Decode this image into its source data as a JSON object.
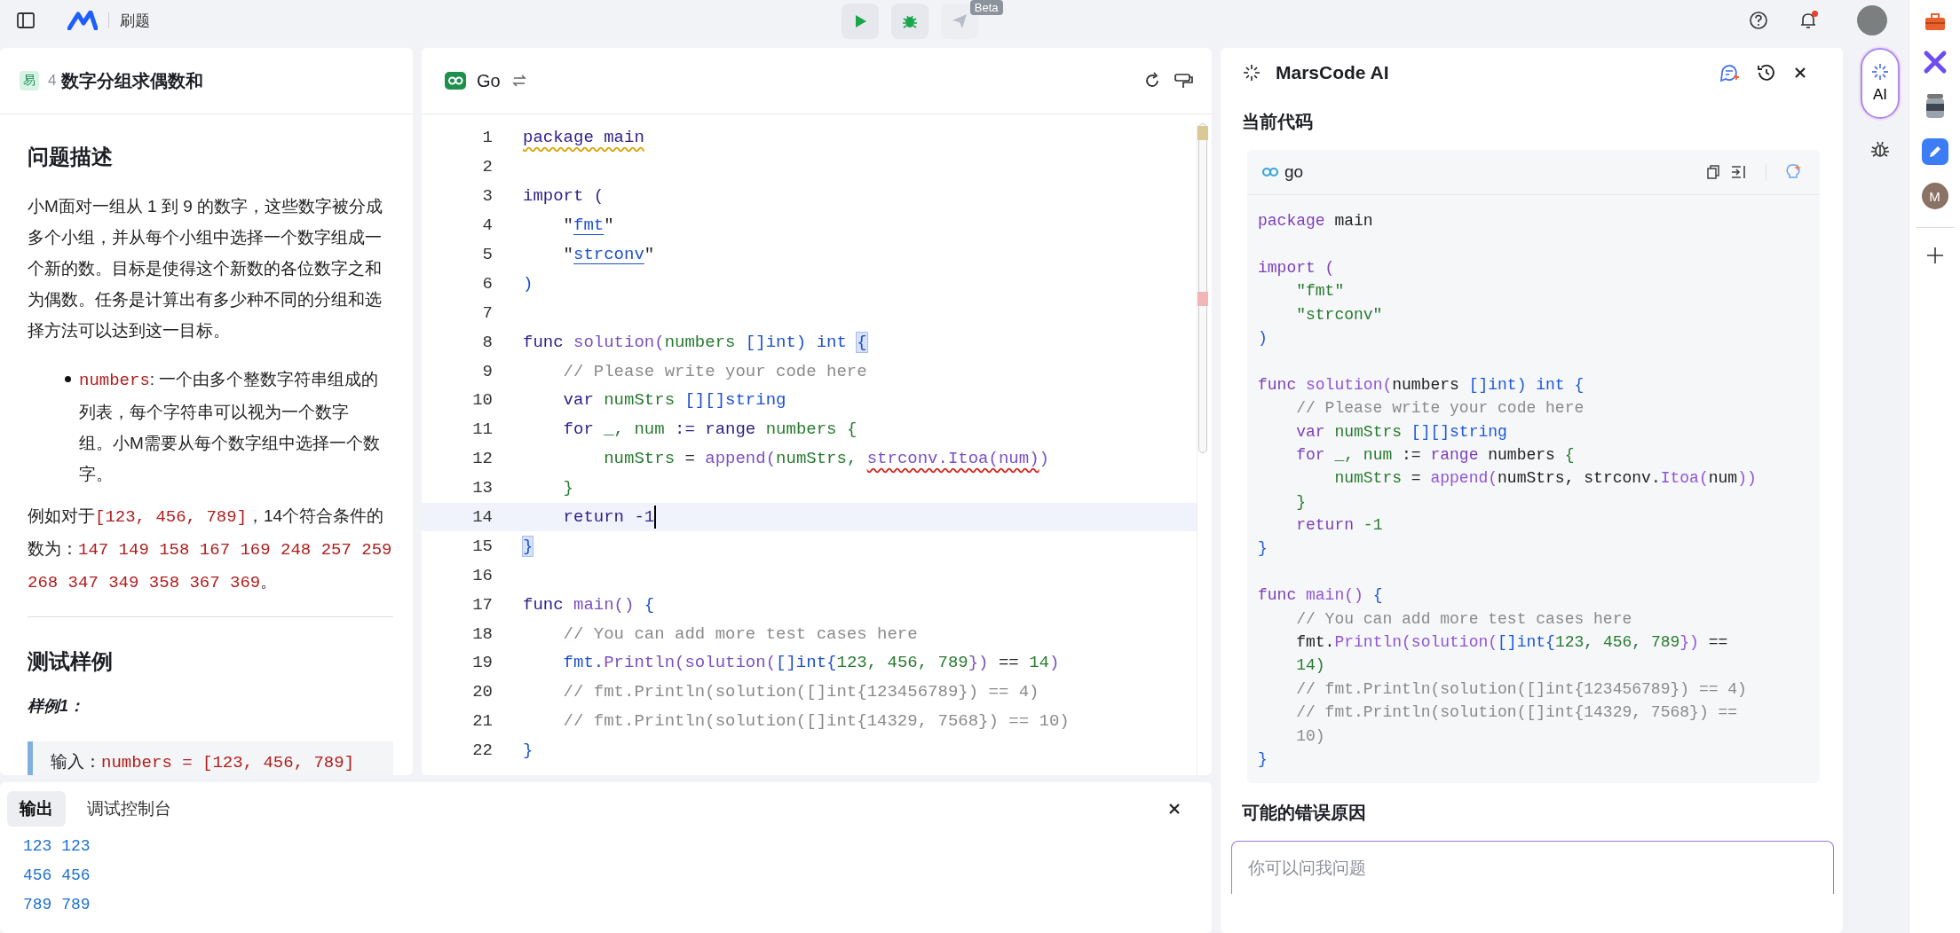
{
  "topbar": {
    "section": "刷题",
    "actions": [
      {
        "kind": "run",
        "disabled": false
      },
      {
        "kind": "debug",
        "disabled": false
      },
      {
        "kind": "submit",
        "disabled": true,
        "badge": "Beta"
      }
    ],
    "bell_unread": true
  },
  "problem": {
    "difficulty": "易",
    "number": "4",
    "title": "数字分组求偶数和",
    "description_heading": "问题描述",
    "description": "小M面对一组从 1 到 9 的数字，这些数字被分成多个小组，并从每个小组中选择一个数字组成一个新的数。目标是使得这个新数的各位数字之和为偶数。任务是计算出有多少种不同的分组和选择方法可以达到这一目标。",
    "params": [
      {
        "name": "numbers",
        "text": ": 一个由多个整数字符串组成的列表，每个字符串可以视为一个数字组。小M需要从每个数字组中选择一个数字。"
      }
    ],
    "example": [
      {
        "text": "例如对于",
        "kind": "text"
      },
      {
        "text": "[123, 456, 789]",
        "kind": "code"
      },
      {
        "text": "，14个符合条件的数为：",
        "kind": "text"
      },
      {
        "text": "147 149 158 167 169 248 257 259 268 347 349 358 367 369",
        "kind": "code"
      },
      {
        "text": "。",
        "kind": "text"
      }
    ],
    "tests_heading": "测试样例",
    "sample_label": "样例1：",
    "sample_input": [
      {
        "text": "输入：",
        "kind": "text"
      },
      {
        "text": "numbers = [123, 456, 789]",
        "kind": "code"
      }
    ]
  },
  "editor": {
    "language": "Go",
    "lines": [
      {
        "number": "1",
        "current": false,
        "kind": "code",
        "tokens": [
          {
            "text": "package main",
            "kind": "warn"
          }
        ]
      },
      {
        "number": "2",
        "current": false,
        "kind": "blank"
      },
      {
        "number": "3",
        "current": false,
        "kind": "code",
        "tokens": [
          {
            "text": "import (",
            "kind": "kw"
          }
        ]
      },
      {
        "number": "4",
        "current": false,
        "kind": "code",
        "tokens": [
          {
            "text": "    \"",
            "kind": "pl"
          },
          {
            "text": "fmt",
            "kind": "link"
          },
          {
            "text": "\"",
            "kind": "pl"
          }
        ]
      },
      {
        "number": "5",
        "current": false,
        "kind": "code",
        "tokens": [
          {
            "text": "    \"",
            "kind": "pl"
          },
          {
            "text": "strconv",
            "kind": "link"
          },
          {
            "text": "\"",
            "kind": "pl"
          }
        ]
      },
      {
        "number": "6",
        "current": false,
        "kind": "code",
        "tokens": [
          {
            "text": ")",
            "kind": "type"
          }
        ]
      },
      {
        "number": "7",
        "current": false,
        "kind": "blank"
      },
      {
        "number": "8",
        "current": false,
        "kind": "code",
        "tokens": [
          {
            "text": "func ",
            "kind": "kw"
          },
          {
            "text": "solution(",
            "kind": "fn"
          },
          {
            "text": "numbers ",
            "kind": "var"
          },
          {
            "text": "[]int) int ",
            "kind": "type"
          },
          {
            "text": "{",
            "kind": "match"
          }
        ]
      },
      {
        "number": "9",
        "current": false,
        "kind": "code",
        "tokens": [
          {
            "text": "    // Please write your code here",
            "kind": "cm"
          }
        ]
      },
      {
        "number": "10",
        "current": false,
        "kind": "code",
        "tokens": [
          {
            "text": "    var ",
            "kind": "kw"
          },
          {
            "text": "numStrs ",
            "kind": "var"
          },
          {
            "text": "[][]string",
            "kind": "type"
          }
        ]
      },
      {
        "number": "11",
        "current": false,
        "kind": "code",
        "tokens": [
          {
            "text": "    for ",
            "kind": "kw"
          },
          {
            "text": "_, num ",
            "kind": "var"
          },
          {
            "text": ":= range ",
            "kind": "kw"
          },
          {
            "text": "numbers {",
            "kind": "var"
          }
        ]
      },
      {
        "number": "12",
        "current": false,
        "kind": "code",
        "tokens": [
          {
            "text": "        numStrs ",
            "kind": "var"
          },
          {
            "text": "= ",
            "kind": "pl"
          },
          {
            "text": "append(",
            "kind": "fn"
          },
          {
            "text": "numStrs, ",
            "kind": "var"
          },
          {
            "text": "strconv.Itoa(num)",
            "kind": "err"
          },
          {
            "text": ")",
            "kind": "fn"
          }
        ]
      },
      {
        "number": "13",
        "current": false,
        "kind": "code",
        "tokens": [
          {
            "text": "    }",
            "kind": "var"
          }
        ]
      },
      {
        "number": "14",
        "current": true,
        "kind": "code",
        "tokens": [
          {
            "text": "    return -1",
            "kind": "kw"
          }
        ]
      },
      {
        "number": "15",
        "current": false,
        "kind": "code",
        "tokens": [
          {
            "text": "}",
            "kind": "match"
          }
        ]
      },
      {
        "number": "16",
        "current": false,
        "kind": "blank"
      },
      {
        "number": "17",
        "current": false,
        "kind": "code",
        "tokens": [
          {
            "text": "func ",
            "kind": "kw"
          },
          {
            "text": "main() ",
            "kind": "fn"
          },
          {
            "text": "{",
            "kind": "type"
          }
        ]
      },
      {
        "number": "18",
        "current": false,
        "kind": "code",
        "tokens": [
          {
            "text": "    // You can add more test cases here",
            "kind": "cm"
          }
        ]
      },
      {
        "number": "19",
        "current": false,
        "kind": "code",
        "tokens": [
          {
            "text": "    fmt.",
            "kind": "type"
          },
          {
            "text": "Println(solution(",
            "kind": "fn"
          },
          {
            "text": "[]int{",
            "kind": "type"
          },
          {
            "text": "123, 456, 789",
            "kind": "num"
          },
          {
            "text": "}) ",
            "kind": "fn"
          },
          {
            "text": "== ",
            "kind": "pl"
          },
          {
            "text": "14",
            "kind": "num"
          },
          {
            "text": ")",
            "kind": "fn"
          }
        ]
      },
      {
        "number": "20",
        "current": false,
        "kind": "code",
        "tokens": [
          {
            "text": "    // fmt.Println(solution([]int{123456789}) == 4)",
            "kind": "cm"
          }
        ]
      },
      {
        "number": "21",
        "current": false,
        "kind": "code",
        "tokens": [
          {
            "text": "    // fmt.Println(solution([]int{14329, 7568}) == 10)",
            "kind": "cm"
          }
        ]
      },
      {
        "number": "22",
        "current": false,
        "kind": "code",
        "tokens": [
          {
            "text": "}",
            "kind": "type"
          }
        ]
      }
    ]
  },
  "output": {
    "tabs": [
      {
        "label": "输出",
        "selected": true
      },
      {
        "label": "调试控制台",
        "selected": false
      }
    ],
    "lines": [
      "123 123",
      "456 456",
      "789 789"
    ]
  },
  "assistant": {
    "title": "MarsCode AI",
    "code_heading": "当前代码",
    "code_language": "go",
    "code_lines": [
      {
        "kind": "code",
        "tokens": [
          {
            "text": "package ",
            "kind": "kw"
          },
          {
            "text": "main",
            "kind": "pl"
          }
        ]
      },
      {
        "kind": "blank"
      },
      {
        "kind": "code",
        "tokens": [
          {
            "text": "import (",
            "kind": "kw"
          }
        ]
      },
      {
        "kind": "code",
        "tokens": [
          {
            "text": "    \"fmt\"",
            "kind": "str"
          }
        ]
      },
      {
        "kind": "code",
        "tokens": [
          {
            "text": "    \"strconv\"",
            "kind": "str"
          }
        ]
      },
      {
        "kind": "code",
        "tokens": [
          {
            "text": ")",
            "kind": "type"
          }
        ]
      },
      {
        "kind": "blank"
      },
      {
        "kind": "code",
        "tokens": [
          {
            "text": "func ",
            "kind": "kw"
          },
          {
            "text": "solution(",
            "kind": "fn"
          },
          {
            "text": "numbers ",
            "kind": "pl"
          },
          {
            "text": "[]int) int {",
            "kind": "type"
          }
        ]
      },
      {
        "kind": "code",
        "tokens": [
          {
            "text": "    // Please write your code here",
            "kind": "cm"
          }
        ]
      },
      {
        "kind": "code",
        "tokens": [
          {
            "text": "    var ",
            "kind": "kw"
          },
          {
            "text": "numStrs ",
            "kind": "var"
          },
          {
            "text": "[][]string",
            "kind": "type"
          }
        ]
      },
      {
        "kind": "code",
        "tokens": [
          {
            "text": "    for ",
            "kind": "kw"
          },
          {
            "text": "_, num ",
            "kind": "var"
          },
          {
            "text": ":= ",
            "kind": "pl"
          },
          {
            "text": "range ",
            "kind": "kw"
          },
          {
            "text": "numbers ",
            "kind": "pl"
          },
          {
            "text": "{",
            "kind": "var"
          }
        ]
      },
      {
        "kind": "code",
        "tokens": [
          {
            "text": "        numStrs ",
            "kind": "var"
          },
          {
            "text": "= ",
            "kind": "pl"
          },
          {
            "text": "append(",
            "kind": "fn"
          },
          {
            "text": "numStrs, strconv.",
            "kind": "pl"
          },
          {
            "text": "Itoa(",
            "kind": "fn"
          },
          {
            "text": "num",
            "kind": "pl"
          },
          {
            "text": "))",
            "kind": "fn"
          }
        ]
      },
      {
        "kind": "code",
        "tokens": [
          {
            "text": "    }",
            "kind": "var"
          }
        ]
      },
      {
        "kind": "code",
        "tokens": [
          {
            "text": "    return ",
            "kind": "kw"
          },
          {
            "text": "-1",
            "kind": "num"
          }
        ]
      },
      {
        "kind": "code",
        "tokens": [
          {
            "text": "}",
            "kind": "type"
          }
        ]
      },
      {
        "kind": "blank"
      },
      {
        "kind": "code",
        "tokens": [
          {
            "text": "func ",
            "kind": "kw"
          },
          {
            "text": "main() ",
            "kind": "fn"
          },
          {
            "text": "{",
            "kind": "type"
          }
        ]
      },
      {
        "kind": "code",
        "tokens": [
          {
            "text": "    // You can add more test cases here",
            "kind": "cm"
          }
        ]
      },
      {
        "kind": "code",
        "tokens": [
          {
            "text": "    fmt.",
            "kind": "pl"
          },
          {
            "text": "Println(solution(",
            "kind": "fn"
          },
          {
            "text": "[]int{",
            "kind": "type"
          },
          {
            "text": "123, 456, 789",
            "kind": "num"
          },
          {
            "text": "}) ",
            "kind": "fn"
          },
          {
            "text": "==",
            "kind": "pl"
          }
        ]
      },
      {
        "kind": "code",
        "tokens": [
          {
            "text": "    14)",
            "kind": "num"
          }
        ]
      },
      {
        "kind": "code",
        "tokens": [
          {
            "text": "    // fmt.Println(solution([]int{123456789}) == 4)",
            "kind": "cm"
          }
        ]
      },
      {
        "kind": "code",
        "tokens": [
          {
            "text": "    // fmt.Println(solution([]int{14329, 7568}) ==",
            "kind": "cm"
          }
        ]
      },
      {
        "kind": "code",
        "tokens": [
          {
            "text": "    10)",
            "kind": "cm"
          }
        ]
      },
      {
        "kind": "code",
        "tokens": [
          {
            "text": "}",
            "kind": "type"
          }
        ]
      }
    ],
    "reasons_heading": "可能的错误原因",
    "input_placeholder": "你可以问我问题"
  },
  "ai_button": {
    "label": "AI",
    "selected": true
  },
  "dock": {
    "avatar_letter": "M"
  }
}
